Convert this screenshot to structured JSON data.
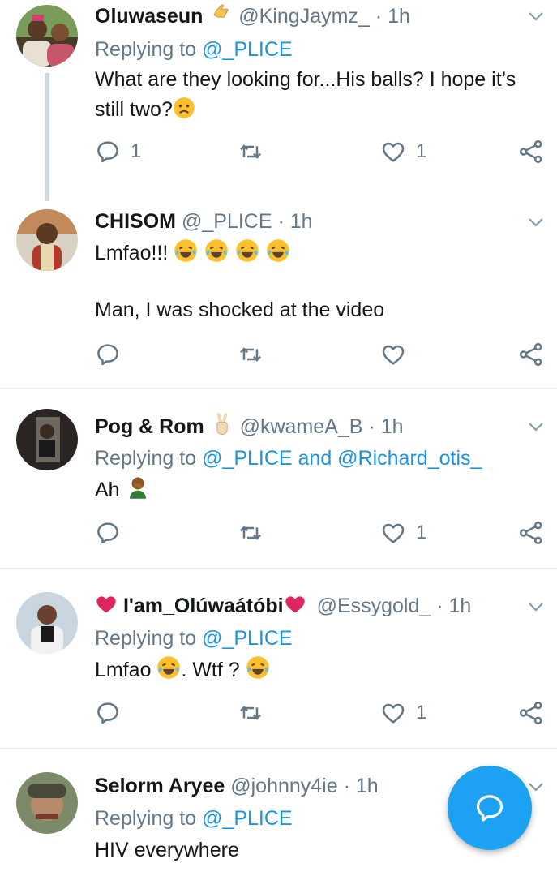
{
  "tweets": [
    {
      "name": "Oluwaseun",
      "handle": "@KingJaymz_",
      "dot": "·",
      "time": "1h",
      "reply_prefix": "Replying to",
      "reply_to": "@_PLICE",
      "text": "What are they looking for...His balls? I hope it’s still two?",
      "reply_count": "1",
      "like_count": "1"
    },
    {
      "name": "CHISOM",
      "handle": "@_PLICE",
      "dot": "·",
      "time": "1h",
      "text_line1": "Lmfao!!!",
      "text_line2": "Man, I was shocked at the video"
    },
    {
      "name": "Pog & Rom",
      "handle": "@kwameA_B",
      "dot": "·",
      "time": "1h",
      "reply_prefix": "Replying to",
      "reply_to": "@_PLICE and @Richard_otis_",
      "text": "Ah",
      "like_count": "1"
    },
    {
      "name": "I'am_Olúwaátóbi",
      "handle": "@Essygold_",
      "dot": "·",
      "time": "1h",
      "reply_prefix": "Replying to",
      "reply_to": "@_PLICE",
      "text_a": "Lmfao",
      "text_b": ". Wtf ?",
      "like_count": "1"
    },
    {
      "name": "Selorm Aryee",
      "handle": "@johnny4ie",
      "dot": "·",
      "time": "1h",
      "reply_prefix": "Replying to",
      "reply_to": "@_PLICE",
      "text": "HIV everywhere"
    }
  ],
  "icons": {
    "reply": "reply-icon",
    "retweet": "retweet-icon",
    "like": "heart-icon",
    "share": "share-icon",
    "caret": "chevron-down-icon",
    "compose": "compose-reply-icon"
  },
  "colors": {
    "accent": "#1da1f2",
    "link": "#1b95e0",
    "muted": "#657786",
    "text": "#14171a",
    "separator": "#e6ecf0"
  }
}
